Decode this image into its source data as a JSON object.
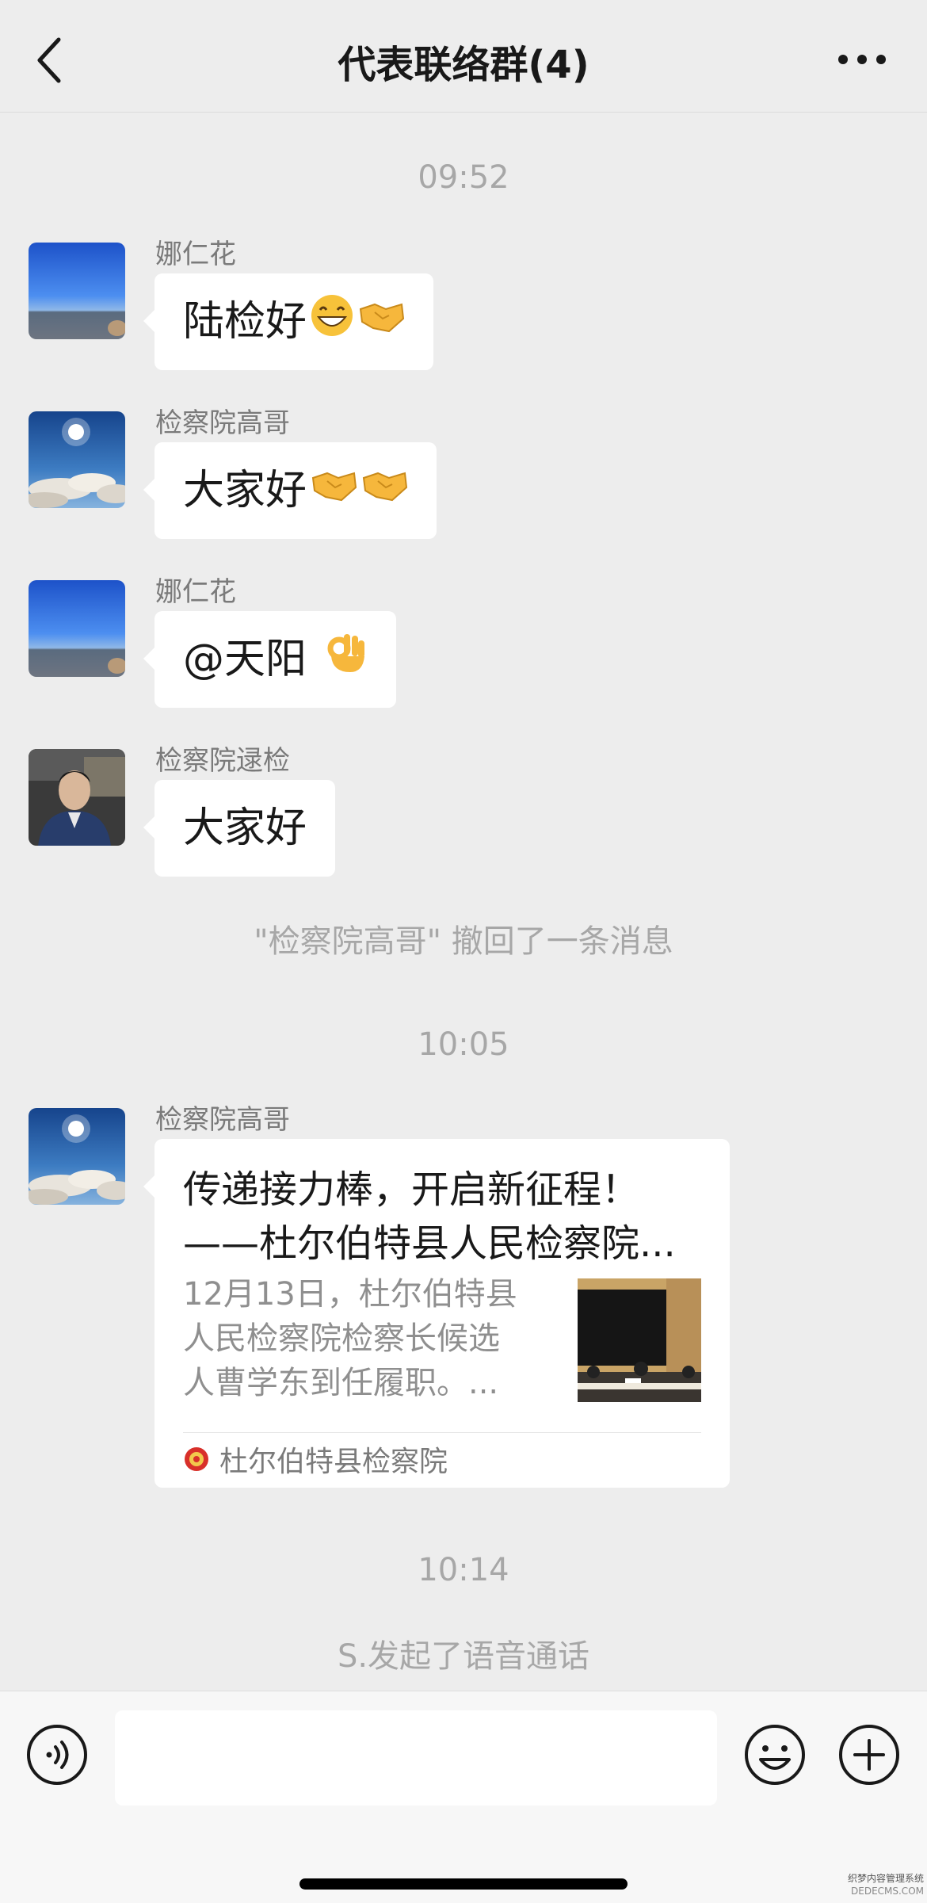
{
  "header": {
    "title": "代表联络群(4)"
  },
  "messages": {
    "time1": "09:52",
    "m1": {
      "sender": "娜仁花",
      "text": "陆检好"
    },
    "m2": {
      "sender": "检察院高哥",
      "text": "大家好"
    },
    "m3": {
      "sender": "娜仁花",
      "text": "@天阳 "
    },
    "m4": {
      "sender": "检察院逯检",
      "text": "大家好"
    },
    "recall": "\"检察院高哥\" 撤回了一条消息",
    "time2": "10:05",
    "m5": {
      "sender": "检察院高哥",
      "card_title_line1": "传递接力棒，开启新征程！",
      "card_title_line2": "——杜尔伯特县人民检察院...",
      "card_desc_line1": "12月13日，杜尔伯特县",
      "card_desc_line2": "人民检察院检察长候选",
      "card_desc_line3": "人曹学东到任履职。...",
      "card_source": "杜尔伯特县检察院"
    },
    "time3": "10:14",
    "call": "S.发起了语音通话"
  },
  "watermark": {
    "line1": "织梦内容管理系统",
    "line2": "DEDECMS.COM"
  },
  "colors": {
    "background": "#ededed",
    "bubble": "#ffffff",
    "meta_text": "#a7a7a7"
  },
  "icons": [
    "back-icon",
    "more-icon",
    "voice-icon",
    "emoji-icon",
    "plus-icon",
    "grin-emoji",
    "handshake-emoji",
    "ok-hand-emoji",
    "seal-icon"
  ]
}
